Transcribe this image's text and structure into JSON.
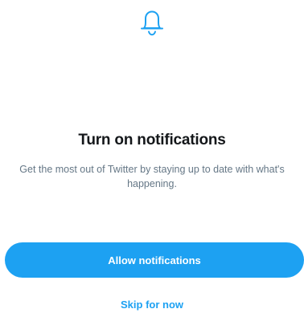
{
  "colors": {
    "accent": "#1da1f2",
    "title_text": "#14171a",
    "secondary_text": "#657786",
    "background": "#ffffff"
  },
  "header": {
    "icon": "bell-icon"
  },
  "main": {
    "title": "Turn on notifications",
    "subtitle": "Get the most out of Twitter by staying up to date with what's happening."
  },
  "actions": {
    "allow_label": "Allow notifications",
    "skip_label": "Skip for now"
  }
}
